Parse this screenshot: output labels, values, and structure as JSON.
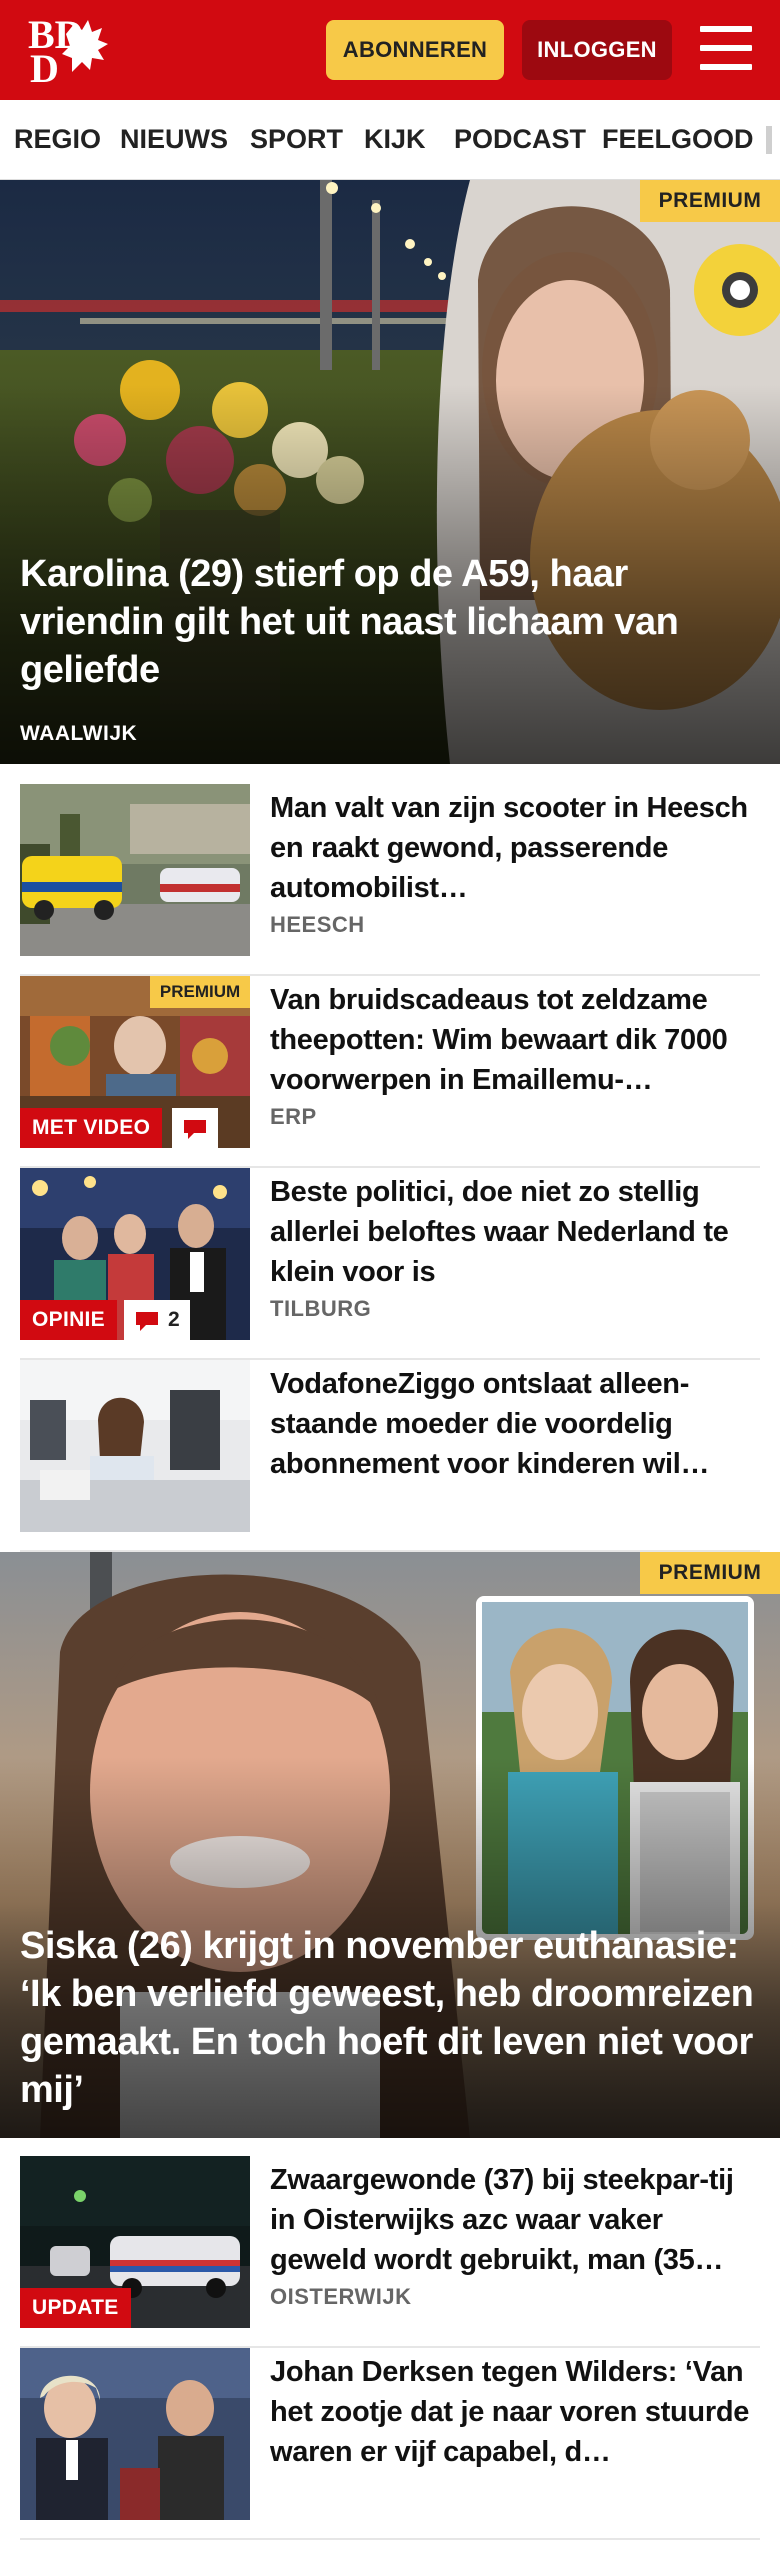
{
  "header": {
    "brand": "BD",
    "subscribe_label": "ABONNEREN",
    "login_label": "INLOGGEN",
    "menu_icon": "hamburger-menu-icon",
    "colors": {
      "brand_red": "#d10a11",
      "premium_yellow": "#f7c948",
      "login_dark_red": "#9d0910"
    }
  },
  "nav": {
    "items": [
      "REGIO",
      "NIEUWS",
      "SPORT",
      "KIJK",
      "PODCAST",
      "FEELGOOD"
    ]
  },
  "hero1": {
    "premium": "PREMIUM",
    "title": "Karolina (29) stierf op de A59, haar vriendin gilt het uit naast lichaam van geliefde",
    "location": "WAALWIJK"
  },
  "list1": [
    {
      "title": "Man valt van zijn scooter in Heesch en raakt gewond, passerende automobilist…",
      "location": "HEESCH"
    },
    {
      "title": "Van bruidscadeaus tot zeldzame theepotten: Wim bewaart dik 7000 voorwerpen in Emaillemu-…",
      "location": "ERP",
      "premium": "PREMIUM",
      "badge": "MET VIDEO",
      "comment_icon": "comment-bubble-icon"
    },
    {
      "title": "Beste politici, doe niet zo stellig allerlei beloftes waar Nederland te klein voor is",
      "location": "TILBURG",
      "badge": "OPINIE",
      "comments": "2",
      "comment_icon": "comment-bubble-icon"
    },
    {
      "title": "VodafoneZiggo ontslaat alleen-staande moeder die voordelig abonnement voor kinderen wil…"
    }
  ],
  "hero2": {
    "premium": "PREMIUM",
    "title": "Siska (26) krijgt in november euthanasie: ‘Ik ben verliefd geweest, heb droomreizen gemaakt. En toch hoeft dit leven niet voor mij’"
  },
  "list2": [
    {
      "title": "Zwaargewonde (37) bij steekpar-tij in Oisterwijks azc waar vaker geweld wordt gebruikt, man (35…",
      "location": "OISTERWIJK",
      "badge": "UPDATE"
    },
    {
      "title": "Johan Derksen tegen Wilders: ‘Van het zootje dat je naar voren stuurde waren er vijf capabel, d…"
    }
  ]
}
